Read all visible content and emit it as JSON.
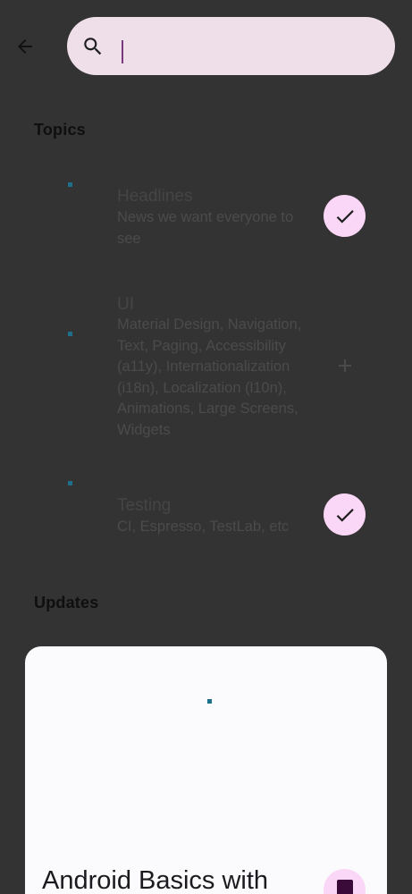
{
  "search": {
    "placeholder": "",
    "value": ""
  },
  "sections": {
    "topics_title": "Topics",
    "updates_title": "Updates"
  },
  "topics": [
    {
      "title": "Headlines",
      "description": "News we want everyone to see",
      "followed": true
    },
    {
      "title": "UI",
      "description": "Material Design, Navigation, Text, Paging, Accessibility (a11y), Internationalization (i18n), Localization (l10n), Animations, Large Screens, Widgets",
      "followed": false
    },
    {
      "title": "Testing",
      "description": "CI, Espresso, TestLab, etc",
      "followed": true
    }
  ],
  "update_card": {
    "title": "Android Basics with"
  },
  "colors": {
    "background": "#333333",
    "search_bar": "#efdfe9",
    "accent_button": "#fbd7f7",
    "icon_dark": "#1f1f1f",
    "card": "#fbfbfd",
    "topic_image_placeholder": "#1e6f8a"
  },
  "icons": {
    "back": "arrow-back-icon",
    "search": "search-icon",
    "followed": "check-icon",
    "not_followed": "add-icon",
    "bookmark": "bookmark-icon"
  }
}
